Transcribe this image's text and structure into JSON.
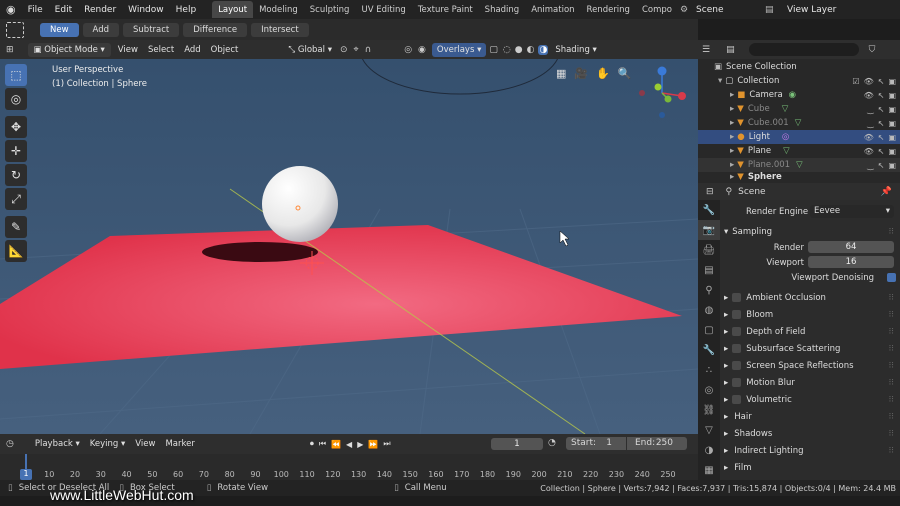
{
  "topbar": {
    "menus": [
      "File",
      "Edit",
      "Render",
      "Window",
      "Help"
    ],
    "workspaces": [
      "Layout",
      "Modeling",
      "Sculpting",
      "UV Editing",
      "Texture Paint",
      "Shading",
      "Animation",
      "Rendering",
      "Compo"
    ],
    "scene_label": "Scene",
    "view_layer_label": "View Layer"
  },
  "tool_options": {
    "buttons": [
      "New",
      "Add",
      "Subtract",
      "Difference",
      "Intersect"
    ]
  },
  "viewport_header": {
    "mode": "Object Mode",
    "menus": [
      "View",
      "Select",
      "Add",
      "Object"
    ],
    "orientation": "Global",
    "overlays": "Overlays",
    "shading": "Shading"
  },
  "viewport": {
    "perspective": "User Perspective",
    "collection": "(1) Collection | Sphere",
    "colors": {
      "plane": "#e0324a",
      "sphere": "#f0f0f0",
      "background": "#3d5470"
    }
  },
  "outliner": {
    "search_placeholder": "",
    "items": [
      {
        "label": "Scene Collection",
        "level": 0
      },
      {
        "label": "Collection",
        "level": 1
      },
      {
        "label": "Camera",
        "level": 2
      },
      {
        "label": "Cube",
        "level": 2
      },
      {
        "label": "Cube.001",
        "level": 2
      },
      {
        "label": "Light",
        "level": 2
      },
      {
        "label": "Plane",
        "level": 2
      },
      {
        "label": "Plane.001",
        "level": 2
      },
      {
        "label": "Sphere",
        "level": 2
      }
    ]
  },
  "properties": {
    "header": "Scene",
    "render_engine_label": "Render Engine",
    "render_engine_value": "Eevee",
    "sampling_label": "Sampling",
    "render_label": "Render",
    "render_value": "64",
    "viewport_label": "Viewport",
    "viewport_value": "16",
    "viewport_denoising_label": "Viewport Denoising",
    "sections": [
      "Ambient Occlusion",
      "Bloom",
      "Depth of Field",
      "Subsurface Scattering",
      "Screen Space Reflections",
      "Motion Blur",
      "Volumetric"
    ],
    "more_sections": [
      "Hair",
      "Shadows",
      "Indirect Lighting",
      "Film"
    ]
  },
  "timeline": {
    "menus": [
      "Playback",
      "Keying",
      "View",
      "Marker"
    ],
    "current_frame": "1",
    "start_label": "Start:",
    "start_value": "1",
    "end_label": "End:",
    "end_value": "250",
    "ticks": [
      "1",
      "10",
      "20",
      "30",
      "40",
      "50",
      "60",
      "70",
      "80",
      "90",
      "100",
      "110",
      "120",
      "130",
      "140",
      "150",
      "160",
      "170",
      "180",
      "190",
      "200",
      "210",
      "220",
      "230",
      "240",
      "250"
    ]
  },
  "status": {
    "select": "Select or Deselect All",
    "box_select": "Box Select",
    "rotate_view": "Rotate View",
    "call_menu": "Call Menu",
    "info": "Collection | Sphere | Verts:7,942 | Faces:7,937 | Tris:15,874 | Objects:0/4 | Mem: 24.4 MB"
  },
  "watermark": "www.LittleWebHut.com"
}
